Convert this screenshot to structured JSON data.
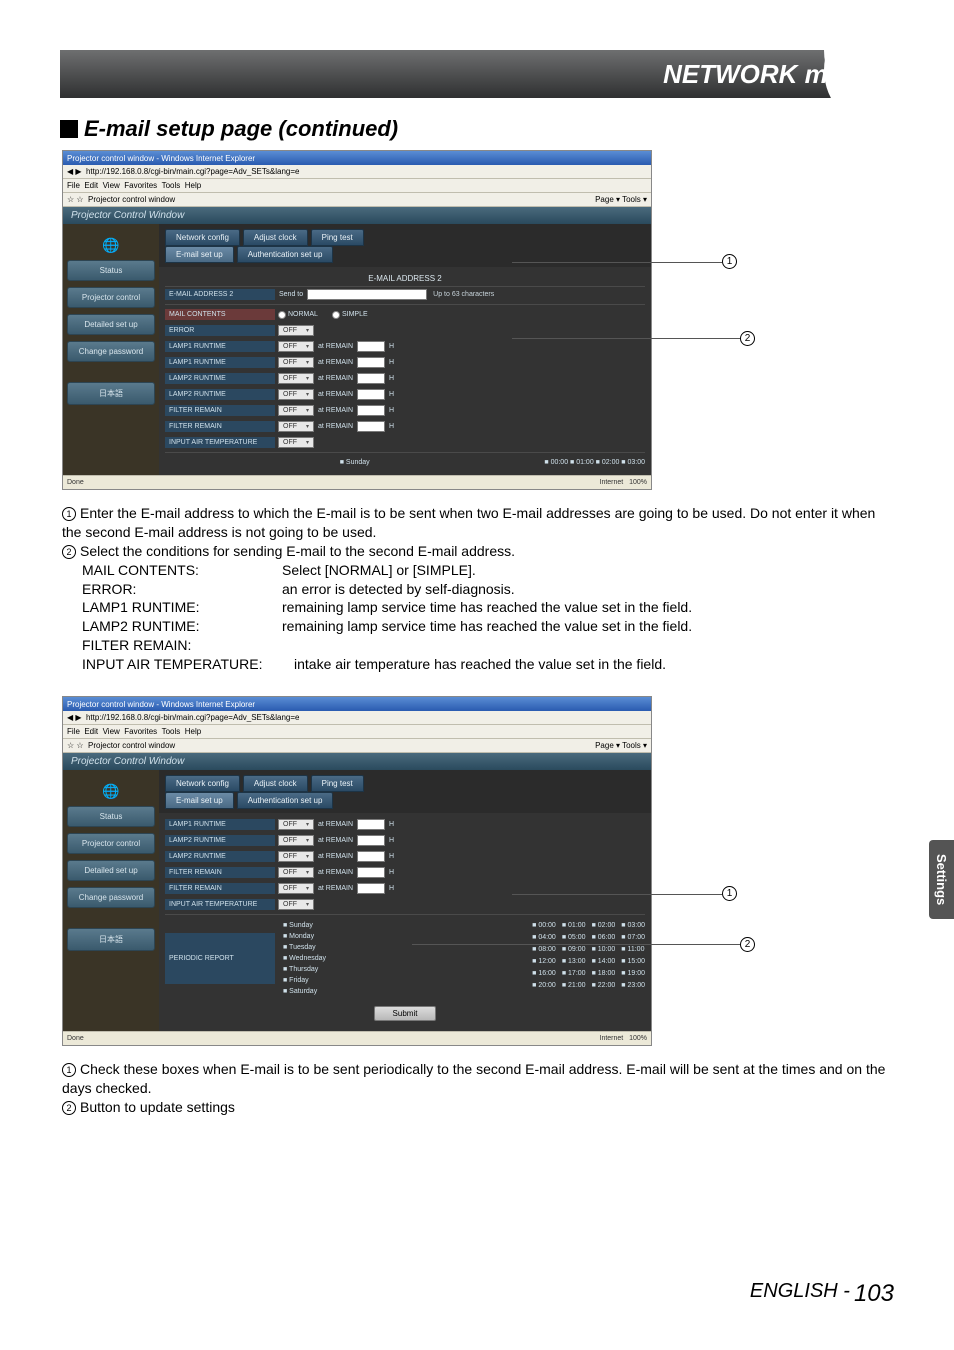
{
  "header": {
    "title": "NETWORK menu"
  },
  "section": {
    "title": "E-mail setup page (continued)"
  },
  "ie": {
    "title": "Projector control window - Windows Internet Explorer",
    "url": "http://192.168.0.8/cgi-bin/main.cgi?page=Adv_SETs&lang=e",
    "menus": [
      "File",
      "Edit",
      "View",
      "Favorites",
      "Tools",
      "Help"
    ],
    "fav": "Projector control window",
    "page_tools": "Page ▾  Tools ▾",
    "status_done": "Done",
    "status_internet": "Internet",
    "status_zoom": "100%"
  },
  "pcw": {
    "title": "Projector Control Window",
    "side": {
      "status": "Status",
      "projector": "Projector control",
      "detailed": "Detailed set up",
      "change": "Change password",
      "jp": "日本語"
    },
    "tabs": {
      "network": "Network config",
      "adjust": "Adjust clock",
      "ping": "Ping test",
      "email": "E-mail set up",
      "auth": "Authentication set up"
    }
  },
  "shot1": {
    "subheader": "E-MAIL ADDRESS 2",
    "rows": {
      "addr": "E-MAIL ADDRESS 2",
      "send": "Send to",
      "hint": "Up to 63 characters",
      "mailc": "MAIL CONTENTS",
      "normal": "NORMAL",
      "simple": "SIMPLE",
      "error": "ERROR",
      "lamp1": "LAMP1 RUNTIME",
      "lamp1b": "LAMP1 RUNTIME",
      "lamp2": "LAMP2 RUNTIME",
      "lamp2b": "LAMP2 RUNTIME",
      "filter": "FILTER REMAIN",
      "filterb": "FILTER REMAIN",
      "input": "INPUT AIR TEMPERATURE",
      "off": "OFF",
      "remain": "at REMAIN",
      "h": "H",
      "sunday": "Sunday",
      "time_legend": "00:00   01:00   02:00   03:00"
    },
    "bottom_row": {
      "sunday": "■ Sunday"
    }
  },
  "text1": {
    "l1": "Enter the E-mail address to which the E-mail is to be sent when two E-mail addresses are going to be used. Do not enter it when the second E-mail address is not going to be used.",
    "l2": "Select the conditions for sending E-mail to the second E-mail address.",
    "defs": {
      "a": {
        "k": "MAIL CONTENTS:",
        "v": "Select [NORMAL] or [SIMPLE]."
      },
      "b": {
        "k": "ERROR:",
        "v": "an error is detected by self-diagnosis."
      },
      "c": {
        "k": "LAMP1 RUNTIME:",
        "v": "remaining lamp service time has reached the value set in the field."
      },
      "d": {
        "k": "LAMP2 RUNTIME:",
        "v": "remaining lamp service time has reached the value set in the field."
      },
      "e": {
        "k": "FILTER REMAIN:",
        "v": ""
      },
      "f": {
        "k": "INPUT AIR TEMPERATURE:",
        "v": "intake air temperature has reached the value set in the field."
      }
    }
  },
  "shot2": {
    "rows": {
      "lamp1": "LAMP1 RUNTIME",
      "lamp2a": "LAMP2 RUNTIME",
      "lamp2b": "LAMP2 RUNTIME",
      "filter": "FILTER REMAIN",
      "filterb": "FILTER REMAIN",
      "input": "INPUT AIR TEMPERATURE",
      "periodic": "PERIODIC REPORT",
      "days": [
        "■ Sunday",
        "■ Monday",
        "■ Tuesday",
        "■ Wednesday",
        "■ Thursday",
        "■ Friday",
        "■ Saturday"
      ],
      "times": [
        "00:00",
        "01:00",
        "02:00",
        "03:00",
        "04:00",
        "05:00",
        "06:00",
        "07:00",
        "08:00",
        "09:00",
        "10:00",
        "11:00",
        "12:00",
        "13:00",
        "14:00",
        "15:00",
        "16:00",
        "17:00",
        "18:00",
        "19:00",
        "20:00",
        "21:00",
        "22:00",
        "23:00"
      ],
      "submit": "Submit"
    }
  },
  "text2": {
    "l1": "Check these boxes when E-mail is to be sent periodically to the second E-mail address. E-mail will be sent at the times and on the days checked.",
    "l2": "Button to update settings"
  },
  "sidetab": "Settings",
  "footer": {
    "lang": "ENGLISH - ",
    "page": "103"
  }
}
